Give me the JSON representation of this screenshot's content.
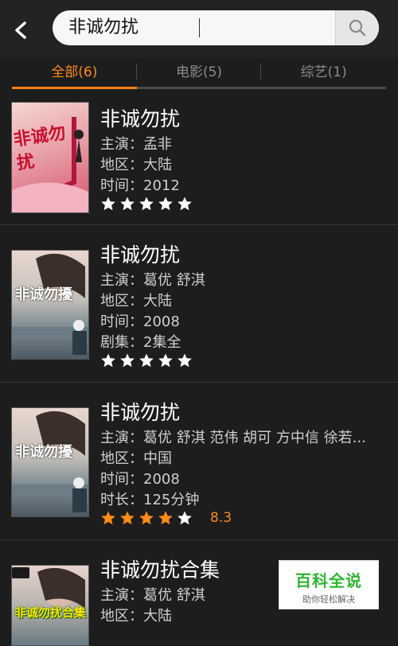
{
  "search": {
    "query": "非诚勿扰"
  },
  "tabs": [
    {
      "label": "全部(6)"
    },
    {
      "label": "电影(5)"
    },
    {
      "label": "综艺(1)"
    }
  ],
  "results": [
    {
      "title": "非诚勿扰",
      "poster_text": "非诚勿扰",
      "lines": [
        "主演：孟非",
        "地区：大陆",
        "时间：2012"
      ],
      "stars": 5,
      "rating": "",
      "star_color": "white"
    },
    {
      "title": "非诚勿扰",
      "poster_text": "非诚勿擾",
      "lines": [
        "主演：葛优 舒淇",
        "地区：大陆",
        "时间：2008",
        "剧集：2集全"
      ],
      "stars": 5,
      "rating": "",
      "star_color": "white"
    },
    {
      "title": "非诚勿扰",
      "poster_text": "非诚勿擾",
      "lines": [
        "主演：葛优 舒淇 范伟 胡可 方中信 徐若...",
        "地区：中国",
        "时间：2008",
        "时长：125分钟"
      ],
      "stars": 4,
      "rating": "8.3",
      "star_color": "orange"
    },
    {
      "title": "非诚勿扰合集",
      "poster_text": "非诚勿扰合集",
      "lines": [
        "主演：葛优 舒淇",
        "地区：大陆"
      ],
      "stars": 0,
      "rating": "",
      "star_color": "white"
    }
  ],
  "watermark": {
    "title": "百科全说",
    "subtitle": "助你轻松解决"
  },
  "colors": {
    "accent": "#ff8a1a",
    "background": "#1d1d1d"
  }
}
